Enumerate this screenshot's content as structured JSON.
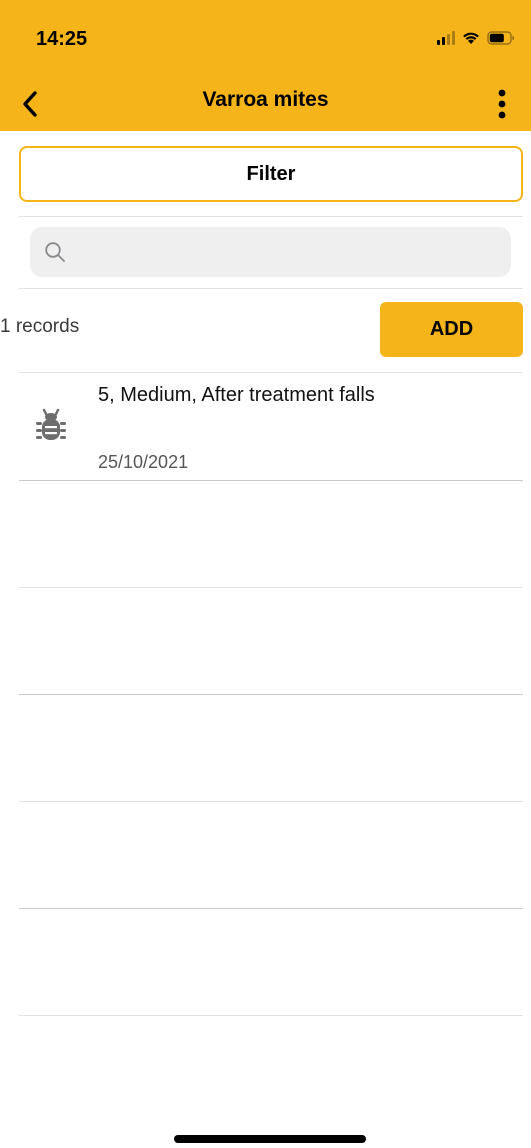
{
  "status_bar": {
    "time": "14:25"
  },
  "nav": {
    "title": "Varroa mites",
    "back_icon": "chevron-left-icon",
    "more_icon": "more-vertical-icon"
  },
  "filter": {
    "label": "Filter"
  },
  "search": {
    "placeholder": "",
    "value": ""
  },
  "list": {
    "count_label": "1 records",
    "add_label": "ADD",
    "items": [
      {
        "title": "5, Medium, After treatment falls",
        "date": "25/10/2021",
        "icon": "bug-icon"
      }
    ]
  },
  "colors": {
    "accent": "#f4b41a",
    "search_bg": "#efeff0"
  }
}
